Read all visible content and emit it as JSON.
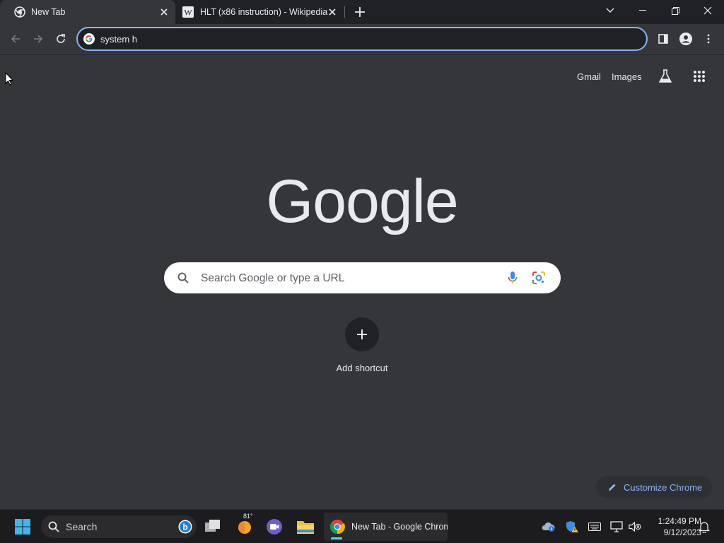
{
  "tabs": [
    {
      "title": "New Tab",
      "active": true,
      "icon": "chrome-icon"
    },
    {
      "title": "HLT (x86 instruction) - Wikipedia",
      "active": false,
      "icon": "wikipedia-icon"
    }
  ],
  "omnibox": {
    "value": "system h"
  },
  "page": {
    "top_links": {
      "gmail": "Gmail",
      "images": "Images"
    },
    "logo_text": "Google",
    "search_placeholder": "Search Google or type a URL",
    "shortcut_label": "Add shortcut",
    "customize_label": "Customize Chrome"
  },
  "taskbar": {
    "search_label": "Search",
    "weather_temp": "81°",
    "chrome_window_label": "New Tab - Google Chrome",
    "time": "1:24:49 PM",
    "date": "9/12/2023"
  },
  "colors": {
    "accent": "#8ab4f8",
    "page_bg": "#35363a",
    "frame_bg": "#202124"
  }
}
